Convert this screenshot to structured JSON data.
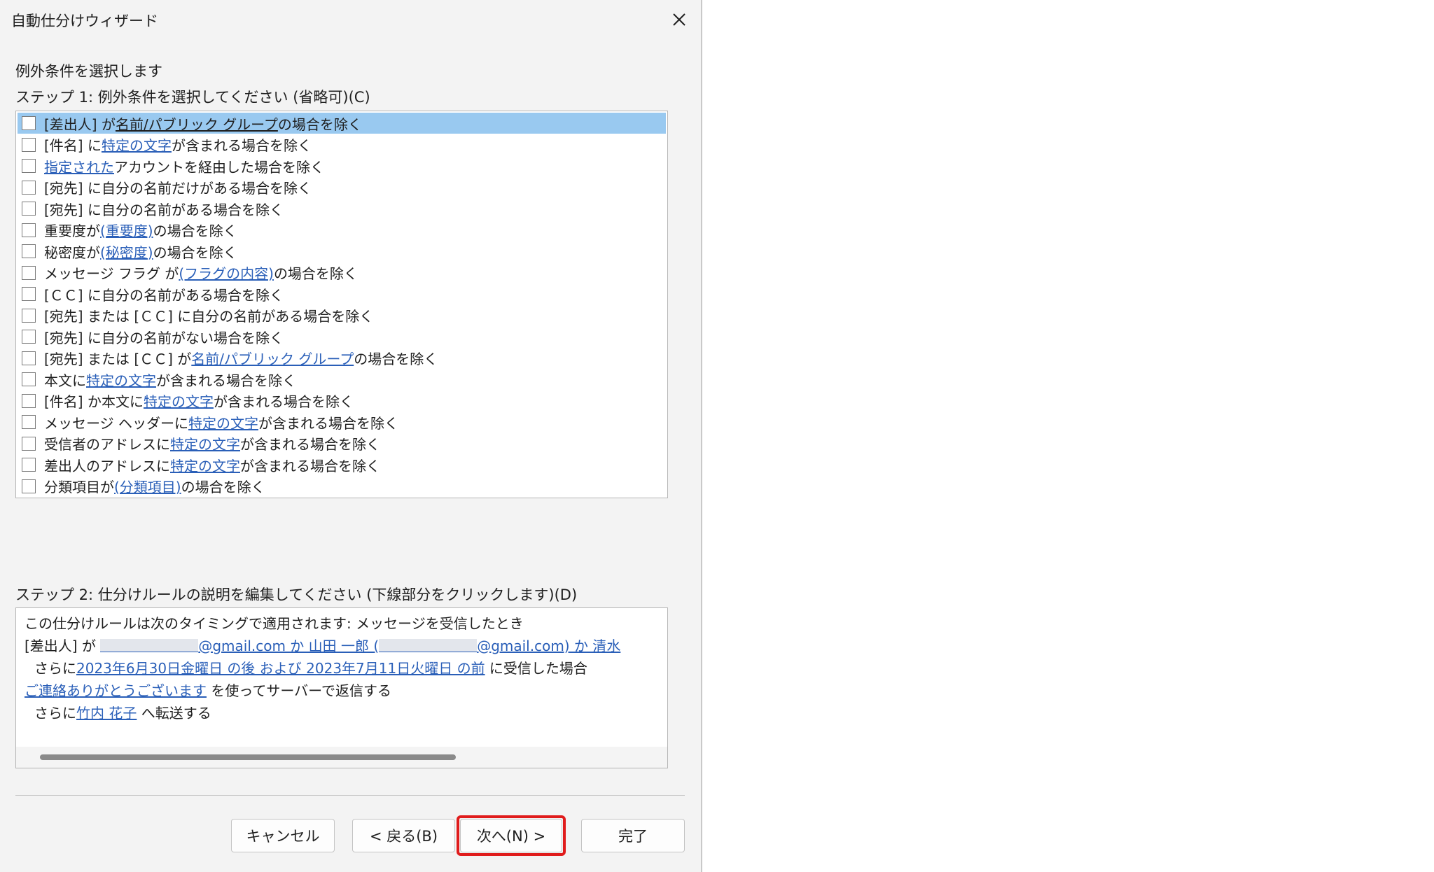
{
  "window": {
    "title": "自動仕分けウィザード",
    "close_icon": "close-icon"
  },
  "heading": "例外条件を選択します",
  "step1_label": "ステップ 1: 例外条件を選択してください (省略可)(C)",
  "conditions": [
    {
      "a": "[差出人] が ",
      "link": "名前/パブリック グループ",
      "b": " の場合を除く"
    },
    {
      "a": "[件名] に ",
      "link": "特定の文字",
      "b": " が含まれる場合を除く"
    },
    {
      "a": "",
      "link": "指定された",
      "b": " アカウントを経由した場合を除く"
    },
    {
      "a": "[宛先] に自分の名前だけがある場合を除く",
      "link": "",
      "b": ""
    },
    {
      "a": "[宛先] に自分の名前がある場合を除く",
      "link": "",
      "b": ""
    },
    {
      "a": "重要度が ",
      "link": "(重要度)",
      "b": " の場合を除く"
    },
    {
      "a": "秘密度が ",
      "link": "(秘密度)",
      "b": " の場合を除く"
    },
    {
      "a": "メッセージ フラグ が ",
      "link": "(フラグの内容)",
      "b": " の場合を除く"
    },
    {
      "a": "[ＣＣ] に自分の名前がある場合を除く",
      "link": "",
      "b": ""
    },
    {
      "a": "[宛先] または [ＣＣ] に自分の名前がある場合を除く",
      "link": "",
      "b": ""
    },
    {
      "a": "[宛先] に自分の名前がない場合を除く",
      "link": "",
      "b": ""
    },
    {
      "a": "[宛先] または [ＣＣ] が ",
      "link": "名前/パブリック グループ",
      "b": " の場合を除く"
    },
    {
      "a": "本文に ",
      "link": "特定の文字",
      "b": " が含まれる場合を除く"
    },
    {
      "a": "[件名] か本文に ",
      "link": "特定の文字",
      "b": " が含まれる場合を除く"
    },
    {
      "a": "メッセージ ヘッダーに ",
      "link": "特定の文字",
      "b": " が含まれる場合を除く"
    },
    {
      "a": "受信者のアドレスに ",
      "link": "特定の文字",
      "b": " が含まれる場合を除く"
    },
    {
      "a": "差出人のアドレスに ",
      "link": "特定の文字",
      "b": " が含まれる場合を除く"
    },
    {
      "a": "分類項目が ",
      "link": "(分類項目)",
      "b": " の場合を除く"
    }
  ],
  "step2_label": "ステップ 2: 仕分けルールの説明を編集してください (下線部分をクリックします)(D)",
  "description": {
    "line1": "この仕分けルールは次のタイミングで適用されます: メッセージを受信したとき",
    "line2_prefix": "[差出人] が ",
    "line2_link_a": "@gmail.com か 山田 一郎 (",
    "line2_link_b": "@gmail.com) か 清水",
    "line3_prefix": "さらに",
    "line3_link": "2023年6月30日金曜日 の後 および 2023年7月11日火曜日 の前",
    "line3_suffix": " に受信した場合",
    "line4_link": "ご連絡ありがとうございます",
    "line4_suffix": " を使ってサーバーで返信する",
    "line5_prefix": "さらに",
    "line5_link": "竹内 花子",
    "line5_suffix": " へ転送する"
  },
  "buttons": {
    "cancel": "キャンセル",
    "back": "< 戻る(B)",
    "next": "次へ(N) >",
    "finish": "完了"
  },
  "highlight_color": "#e01c1c",
  "selection_color": "#99c9f0",
  "link_color": "#2a5fb8"
}
